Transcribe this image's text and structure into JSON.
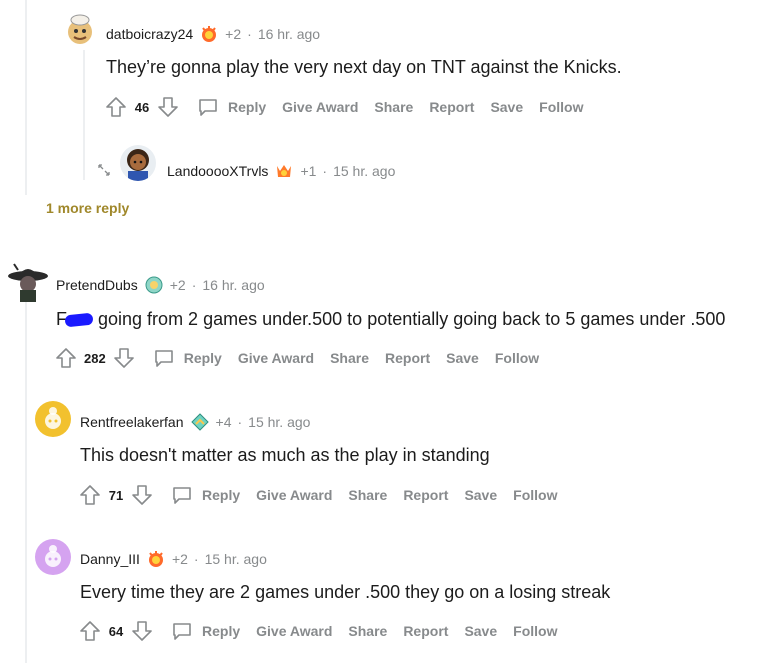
{
  "comments": [
    {
      "author": "datboicrazy24",
      "score": "+2",
      "time": "16 hr. ago",
      "body": "They’re gonna play the very next day on TNT against the Knicks.",
      "votes": "46"
    },
    {
      "author": "LandooooXTrvls",
      "score": "+1",
      "time": "15 hr. ago"
    },
    {
      "author": "PretendDubs",
      "score": "+2",
      "time": "16 hr. ago",
      "body_prefix": "F",
      "body": "going from 2 games under.500 to potentially going back to 5 games under .500",
      "votes": "282"
    },
    {
      "author": "Rentfreelakerfan",
      "score": "+4",
      "time": "15 hr. ago",
      "body": "This doesn't matter as much as the play in standing",
      "votes": "71"
    },
    {
      "author": "Danny_III",
      "score": "+2",
      "time": "15 hr. ago",
      "body": "Every time they are 2 games under .500 they go on a losing streak",
      "votes": "64"
    }
  ],
  "actions": {
    "reply": "Reply",
    "give_award": "Give Award",
    "share": "Share",
    "report": "Report",
    "save": "Save",
    "follow": "Follow"
  },
  "more_reply": "1 more reply",
  "separator": "·",
  "icons": {
    "upvote": "upvote-arrow-icon",
    "downvote": "downvote-arrow-icon",
    "reply": "speech-bubble-icon",
    "expand": "expand-arrows-icon",
    "award": "award-badge-icon"
  },
  "colors": {
    "meta_gray": "#878a8c",
    "more_reply_gold": "#a0882b",
    "thread_line": "#edeff1"
  }
}
